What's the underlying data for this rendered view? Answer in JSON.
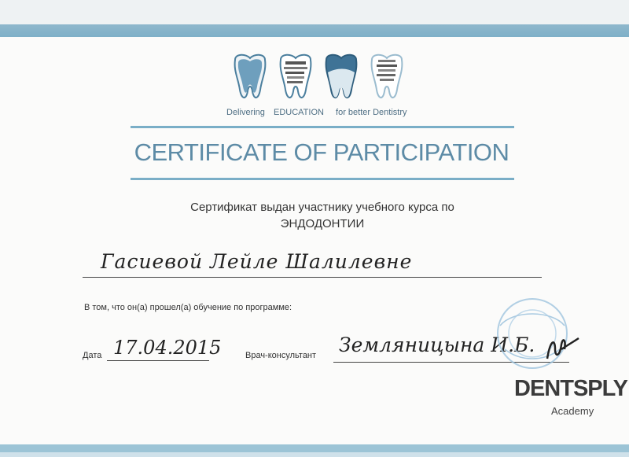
{
  "header": {
    "logo_names": [
      "tooth-logo-1",
      "tooth-logo-2",
      "tooth-logo-3",
      "tooth-logo-4"
    ],
    "tagline": [
      "Delivering",
      "EDUCATION",
      "for better Dentistry"
    ]
  },
  "certificate": {
    "title": "CERTIFICATE OF PARTICIPATION",
    "issued_line1": "Сертификат выдан участнику учебного курса по",
    "issued_line2": "ЭНДОДОНТИИ",
    "participant_name": "Гасиевой Лейле Шалилевне",
    "program_text": "В том, что он(а) прошел(а) обучение по программе:",
    "date_label": "Дата",
    "date_value": "17.04.2015",
    "consultant_label": "Врач-консультант",
    "consultant_value": "Земляницына И.Б."
  },
  "brand": {
    "name": "DENTSPLY",
    "sub": "Academy"
  },
  "colors": {
    "accent": "#7aaec7",
    "title": "#5d8ba6",
    "text": "#333333"
  }
}
